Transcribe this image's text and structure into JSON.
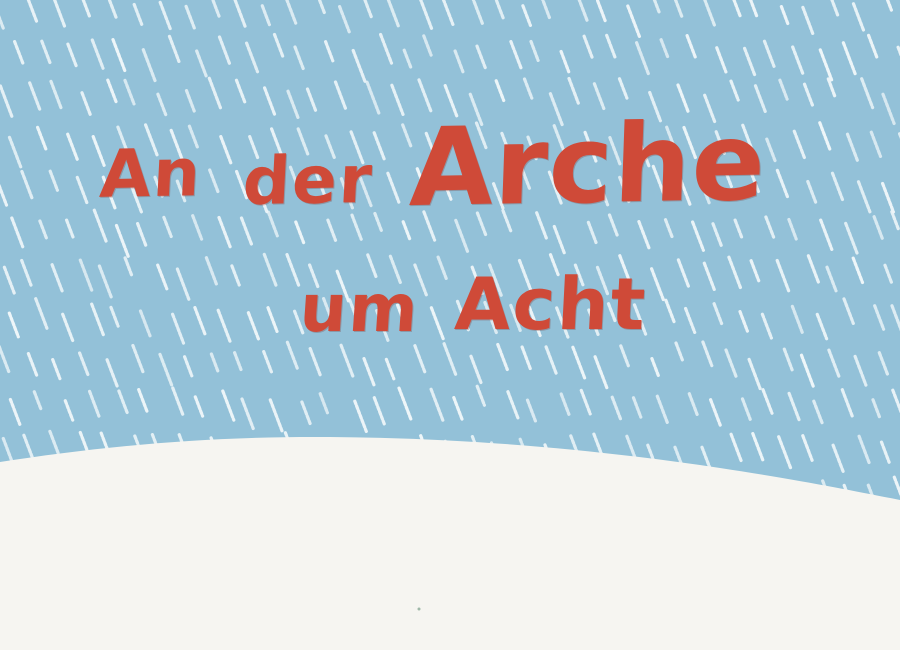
{
  "title": {
    "line1_word1": "An",
    "line1_word2": "der",
    "line1_word3": "Arche",
    "line2_word1": "um",
    "line2_word2": "Acht"
  },
  "colors": {
    "sky": "#93c1d8",
    "rain": "#eef6f9",
    "ground": "#f6f5f1",
    "title": "#cf4a38"
  },
  "decor": {
    "rain_icon": "rain-streaks-icon",
    "hill_icon": "snow-hill-icon"
  }
}
